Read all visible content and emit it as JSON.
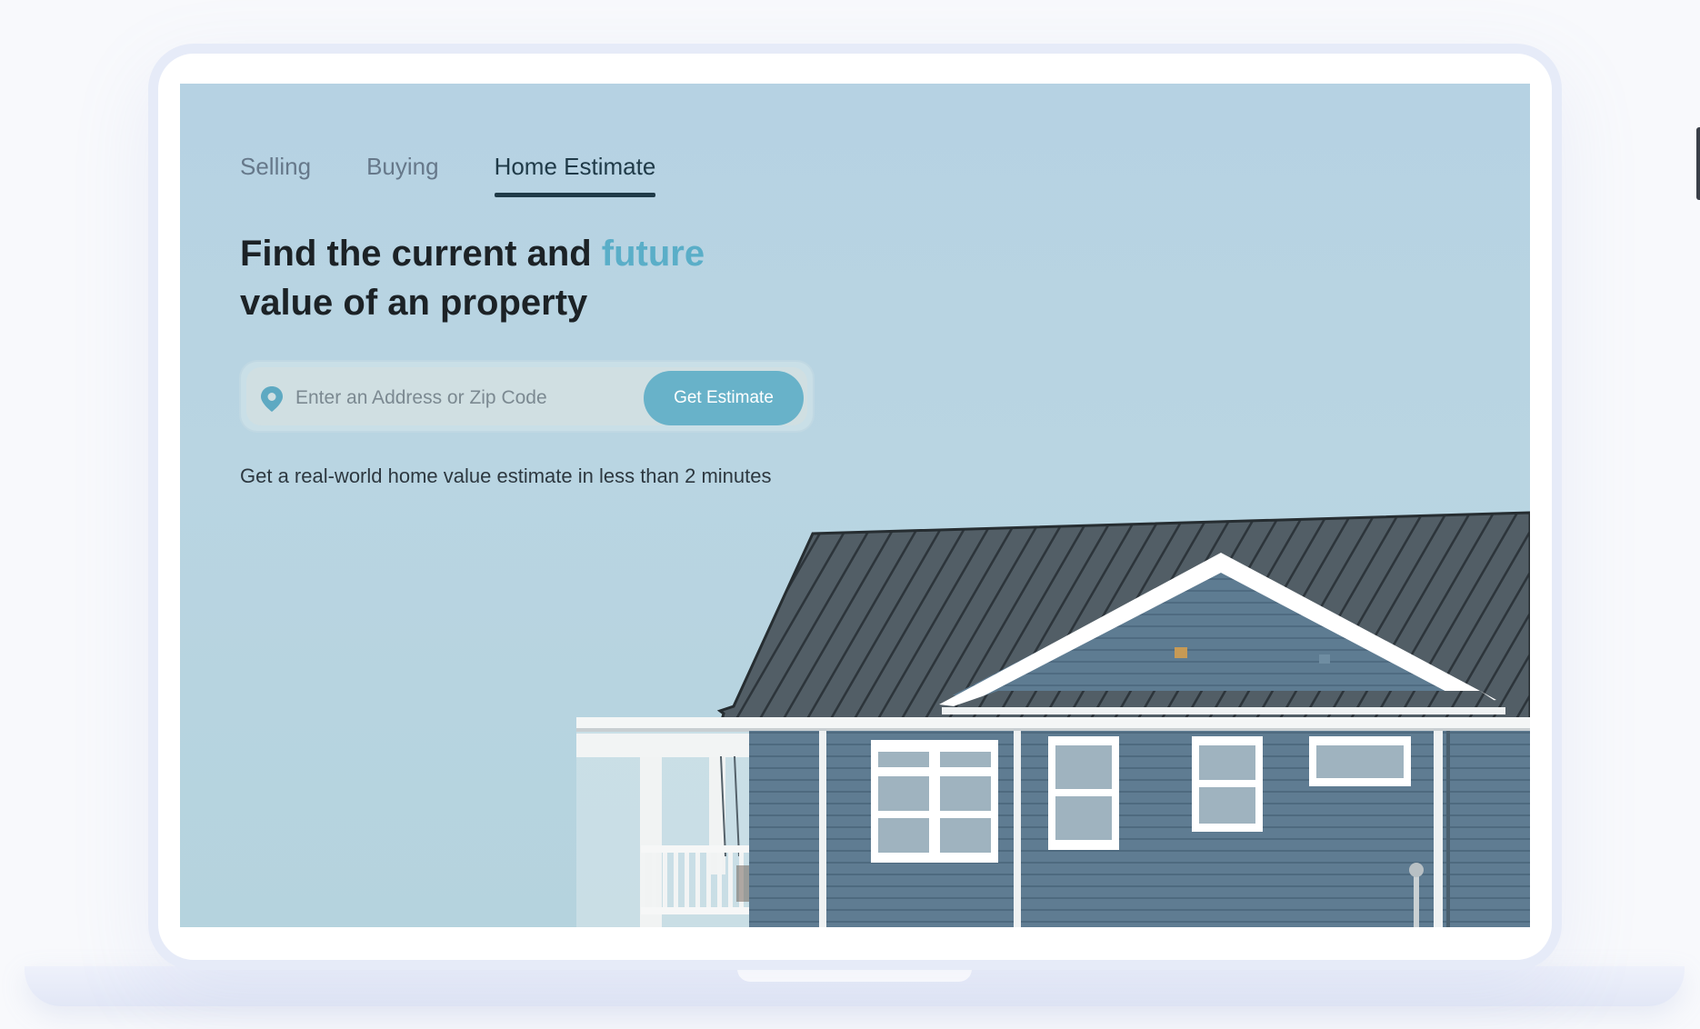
{
  "tabs": [
    {
      "label": "Selling",
      "active": false
    },
    {
      "label": "Buying",
      "active": false
    },
    {
      "label": "Home Estimate",
      "active": true
    }
  ],
  "hero": {
    "headline_part1": "Find the current and ",
    "headline_accent": "future",
    "headline_part2": "value of an property",
    "subtext": "Get a real-world home value estimate in less than 2 minutes"
  },
  "search": {
    "placeholder": "Enter an Address or Zip Code",
    "value": "",
    "button_label": "Get Estimate",
    "icon": "location-pin-icon"
  },
  "colors": {
    "accent": "#68b2c9",
    "headline_accent": "#5aaec8",
    "tab_active": "#1f3a48",
    "sky": "#b8d4e2",
    "roof": "#4f5b62",
    "siding": "#5f7d93"
  }
}
